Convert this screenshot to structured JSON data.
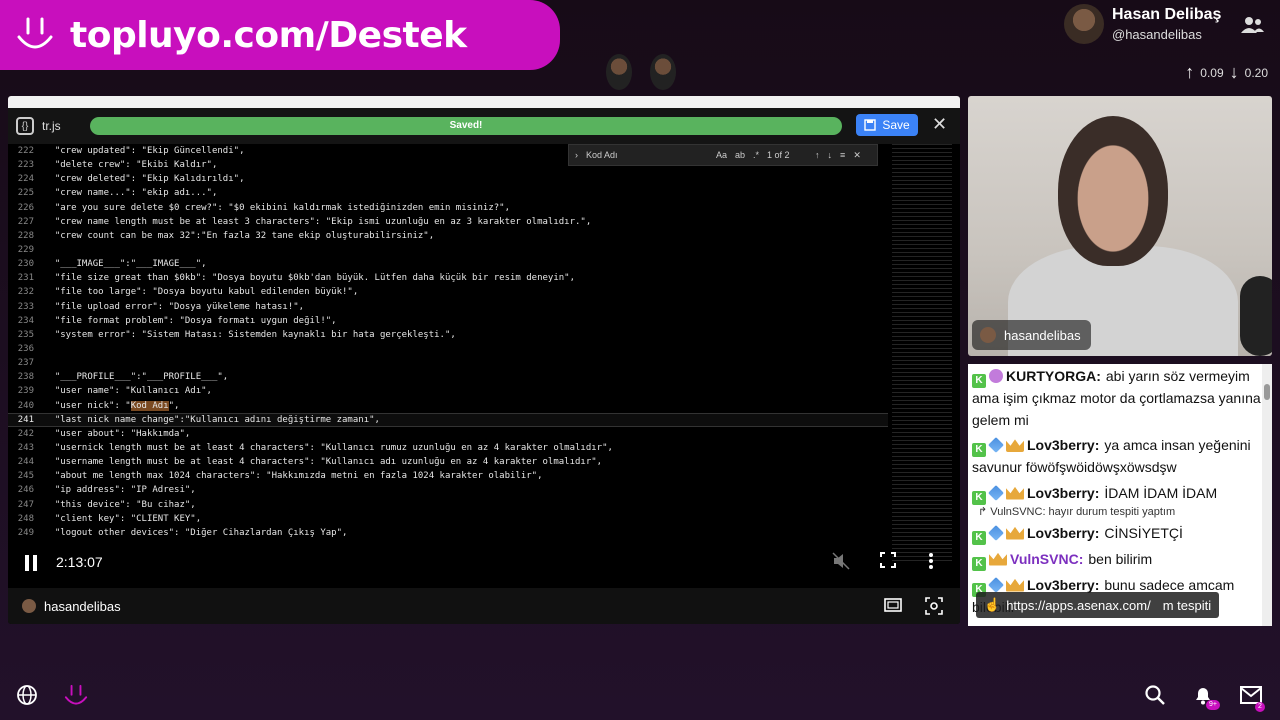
{
  "banner": {
    "url": "topluyo.com/Destek"
  },
  "streamer": {
    "name": "Hasan Delibaş",
    "handle": "@hasandelibas"
  },
  "stats": {
    "up": "0.09",
    "down": "0.20"
  },
  "editor": {
    "file_name": "tr.js",
    "saved_label": "Saved!",
    "save_label": "Save",
    "find_query": "Kod Adı",
    "find_count": "1 of 2",
    "lines": [
      {
        "n": "222",
        "t": "  \"crew updated\": \"Ekip Güncellendi\","
      },
      {
        "n": "223",
        "t": "  \"delete crew\": \"Ekibi Kaldır\","
      },
      {
        "n": "224",
        "t": "  \"crew deleted\": \"Ekip Kalıdırıldı\","
      },
      {
        "n": "225",
        "t": "  \"crew name...\": \"ekip adı...\","
      },
      {
        "n": "226",
        "t": "  \"are you sure delete $0 crew?\": \"$0 ekibini kaldırmak istediğinizden emin misiniz?\","
      },
      {
        "n": "227",
        "t": "  \"crew name length must be at least 3 characters\": \"Ekip ismi uzunluğu en az 3 karakter olmalıdır.\","
      },
      {
        "n": "228",
        "t": "  \"crew count can be max 32\":\"En fazla 32 tane ekip oluşturabilirsiniz\","
      },
      {
        "n": "229",
        "t": ""
      },
      {
        "n": "230",
        "t": "  \"___IMAGE___\":\"___IMAGE___\","
      },
      {
        "n": "231",
        "t": "  \"file size great than $0kb\": \"Dosya boyutu $0kb'dan büyük. Lütfen daha küçük bir resim deneyin\","
      },
      {
        "n": "232",
        "t": "  \"file too large\": \"Dosya boyutu kabul edilenden büyük!\","
      },
      {
        "n": "233",
        "t": "  \"file upload error\": \"Dosya yükeleme hatası!\","
      },
      {
        "n": "234",
        "t": "  \"file format problem\": \"Dosya formatı uygun değil!\","
      },
      {
        "n": "235",
        "t": "  \"system error\": \"Sistem Hatası: Sistemden kaynaklı bir hata gerçekleşti.\","
      },
      {
        "n": "236",
        "t": ""
      },
      {
        "n": "237",
        "t": ""
      },
      {
        "n": "238",
        "t": "  \"___PROFILE___\":\"___PROFILE___\","
      },
      {
        "n": "239",
        "t": "  \"user name\": \"Kullanıcı Adı\","
      },
      {
        "n": "240",
        "t": "  \"user nick\": \"Kod Adı\","
      },
      {
        "n": "241",
        "t": "  \"last nick name change\":\"Kullanıcı adını değiştirme zamanı\","
      },
      {
        "n": "242",
        "t": "  \"user about\": \"Hakkımda\","
      },
      {
        "n": "243",
        "t": "  \"usernick length must be at least 4 characters\": \"Kullanıcı rumuz uzunluğu en az 4 karakter olmalıdır\","
      },
      {
        "n": "244",
        "t": "  \"username length must be at least 4 characters\": \"Kullanıcı adı uzunluğu en az 4 karakter olmalıdır\","
      },
      {
        "n": "245",
        "t": "  \"about me length max 1024 characters\": \"Hakkımızda metni en fazla 1024 karakter olabilir\","
      },
      {
        "n": "246",
        "t": "  \"ip address\": \"IP Adresi\","
      },
      {
        "n": "247",
        "t": "  \"this device\": \"Bu cihaz\","
      },
      {
        "n": "248",
        "t": "  \"client key\": \"CLIENT KEY\","
      },
      {
        "n": "249",
        "t": "  \"logout other devices\": \"Diğer Cihazlardan Çıkış Yap\","
      }
    ],
    "active_line": "241"
  },
  "player": {
    "time": "2:13:07",
    "channel": "hasandelibas"
  },
  "cam": {
    "label": "hasandelibas"
  },
  "chat": {
    "messages": [
      {
        "user": "KURTYORGA:",
        "text": "abi yarın söz vermeyim ama işim çıkmaz motor da çortlamazsa yanına gelem mi",
        "color": "#111",
        "badges": [
          "k",
          "sub"
        ]
      },
      {
        "user": "Lov3berry:",
        "text": "ya amca insan yeğenini savunur föwöfşwöidöwşxöwsdşw",
        "color": "#111",
        "badges": [
          "k",
          "sword",
          "crown"
        ]
      },
      {
        "user": "Lov3berry:",
        "text": "İDAM İDAM İDAM",
        "color": "#111",
        "badges": [
          "k",
          "sword",
          "crown"
        ],
        "reply": "↱ VulnSVNC: hayır durum tespiti yaptım"
      },
      {
        "user": "Lov3berry:",
        "text": "CİNSİYETÇİ",
        "color": "#111",
        "badges": [
          "k",
          "sword",
          "crown"
        ]
      },
      {
        "user": "VulnSVNC:",
        "text": "ben bilirim",
        "color": "#7c2fbf",
        "badges": [
          "k",
          "crown"
        ]
      },
      {
        "user": "Lov3berry:",
        "text": "bunu sadece amcam bilebilir",
        "color": "#111",
        "badges": [
          "k",
          "sword",
          "crown"
        ]
      }
    ],
    "link_toast": "https://apps.asenax.com/",
    "toast_trailing": "m tespiti"
  },
  "nav": {
    "notifications": "9+",
    "messages": "2"
  }
}
